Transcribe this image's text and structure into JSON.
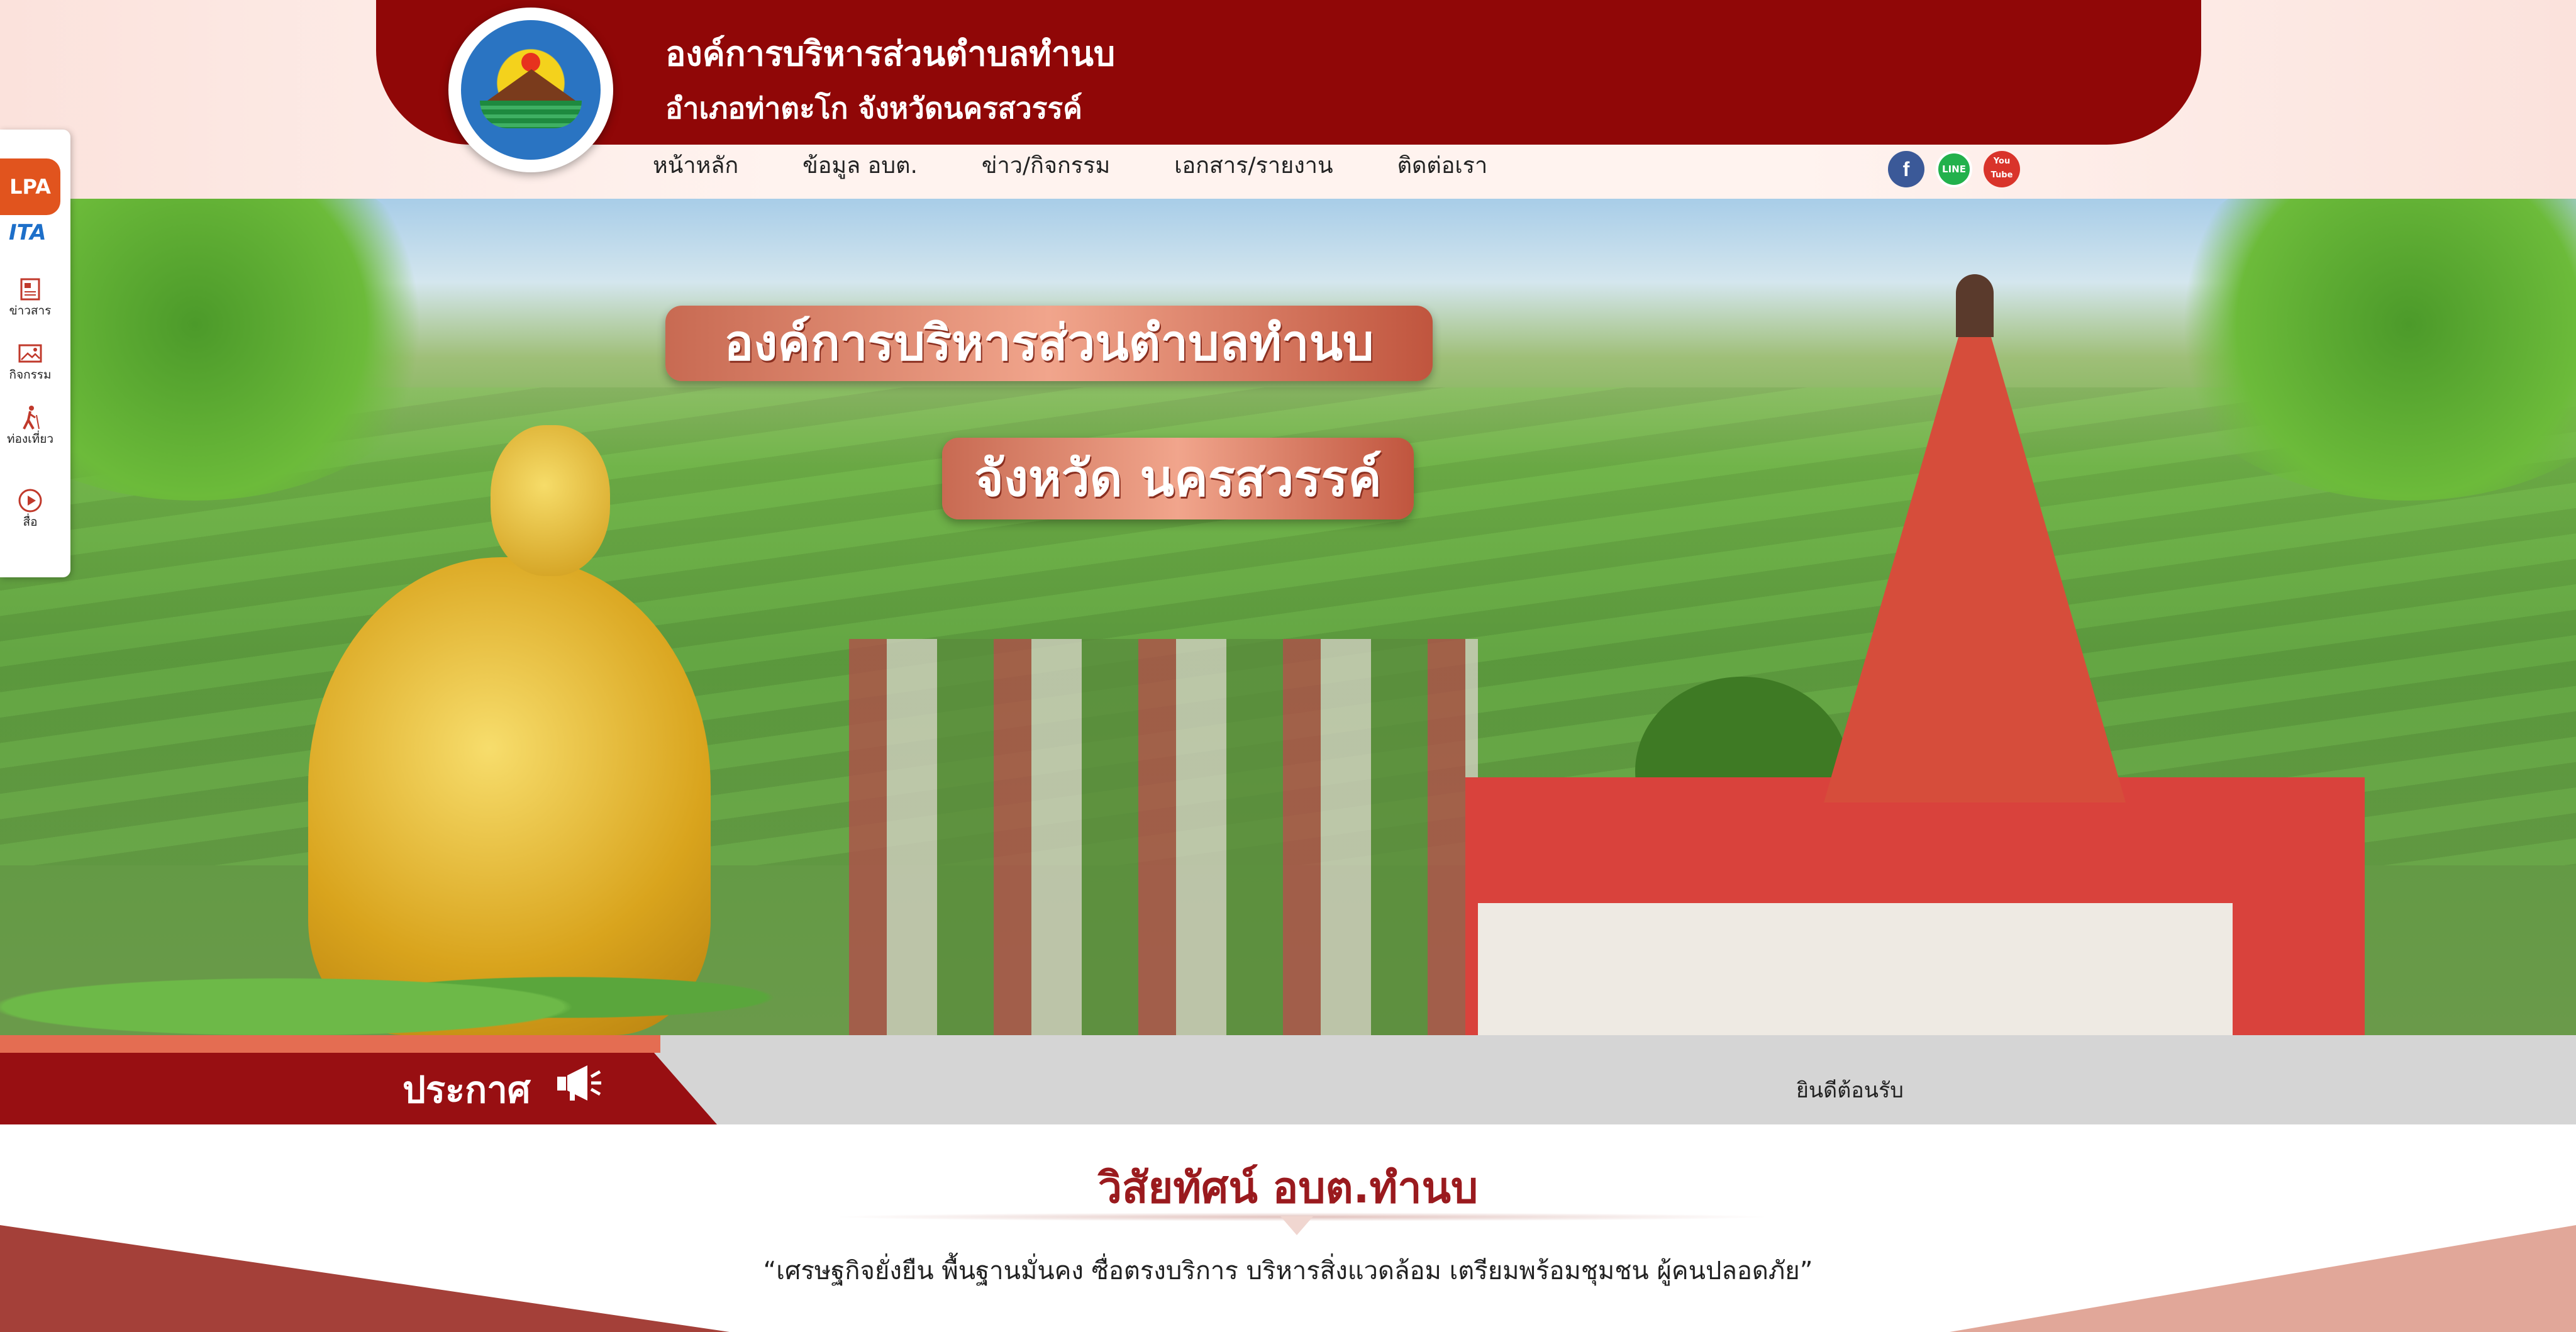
{
  "header": {
    "org_name": "องค์การบริหารส่วนตำบลทำนบ",
    "org_location": "อำเภอท่าตะโก จังหวัดนครสวรรค์"
  },
  "nav": {
    "items": [
      "หน้าหลัก",
      "ข้อมูล อบต.",
      "ข่าว/กิจกรรม",
      "เอกสาร/รายงาน",
      "ติดต่อเรา"
    ]
  },
  "social": {
    "facebook_label": "f",
    "line_label": "LINE",
    "youtube_label": "You Tube"
  },
  "hero": {
    "banner_title": "องค์การบริหารส่วนตำบลทำนบ",
    "banner_subtitle": "จังหวัด นครสวรรค์"
  },
  "announcement": {
    "label": "ประกาศ",
    "text": "ยินดีต้อนรับ"
  },
  "vision": {
    "title": "วิสัยทัศน์ อบต.ทำนบ",
    "text": "“เศรษฐกิจยั่งยืน พื้นฐานมั่นคง ซื่อตรงบริการ บริหารสิ่งแวดล้อม เตรียมพร้อมชุมชน ผู้คนปลอดภัย”"
  },
  "sidebar": {
    "lpa_label": "LPA",
    "ita_label": "ITA",
    "items": [
      {
        "label": "ข่าวสาร",
        "icon": "newspaper-icon"
      },
      {
        "label": "กิจกรรม",
        "icon": "image-icon"
      },
      {
        "label": "ท่องเที่ยว",
        "icon": "hiker-icon"
      },
      {
        "label": "สื่อ",
        "icon": "play-icon"
      }
    ]
  },
  "colors": {
    "brand_red": "#900707",
    "accent_orange": "#e1541e",
    "facebook_blue": "#3b5998",
    "line_green": "#22b14c",
    "youtube_red": "#d9342b"
  }
}
